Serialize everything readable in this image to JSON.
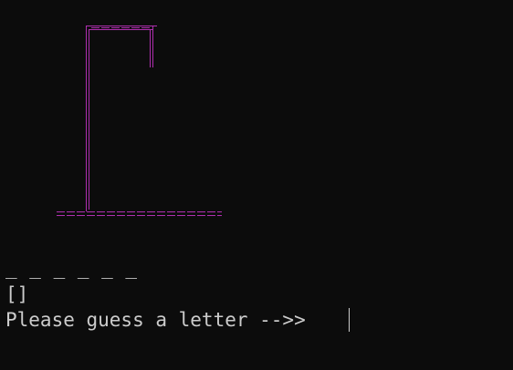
{
  "terminal": {
    "word_blanks": "_ _ _ _ _ _",
    "guessed_letters": "[]",
    "prompt": "Please guess a letter -->>"
  },
  "colors": {
    "background": "#0c0c0c",
    "text": "#cccccc",
    "gallows": "#b02fb0"
  }
}
